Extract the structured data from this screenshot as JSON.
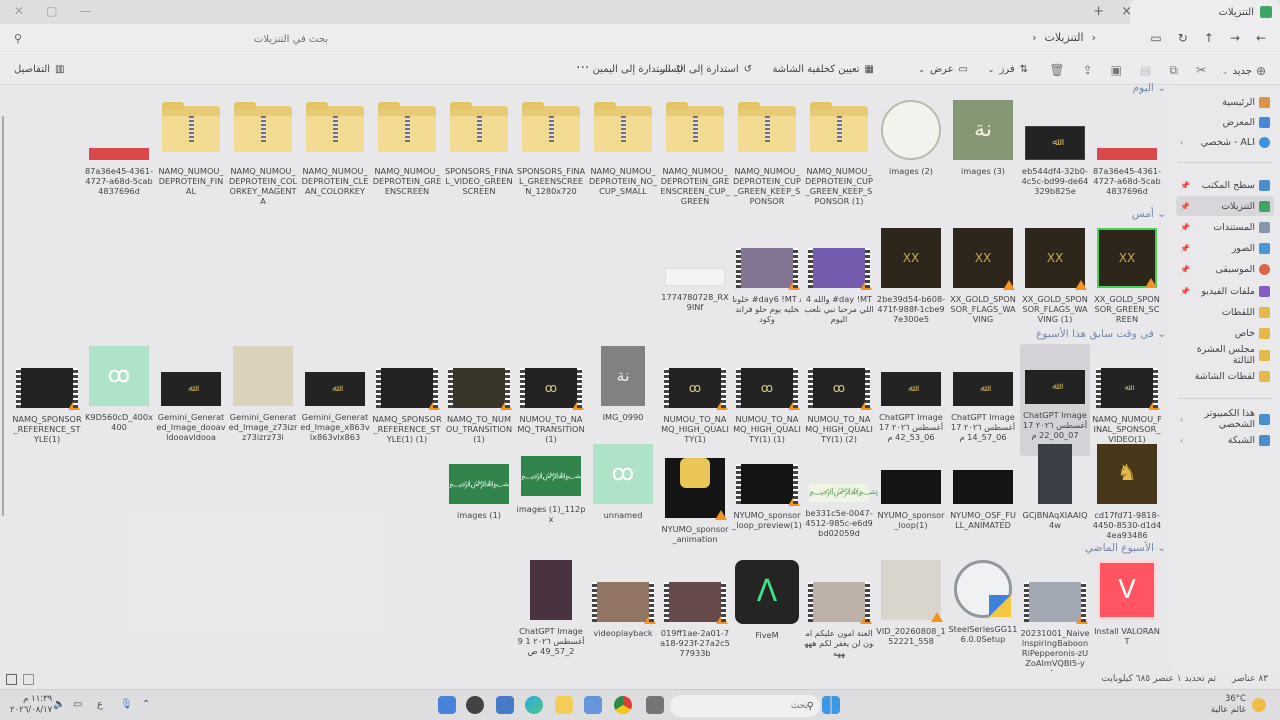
{
  "window": {
    "tab_title": "التنزيلات",
    "new_tab": "+",
    "close_tab": "×"
  },
  "address": {
    "crumbs": [
      "التنزيلات",
      "›"
    ],
    "search_placeholder": "بحث في التنزيلات"
  },
  "toolbar": {
    "new_label": "جديد",
    "sort_label": "فرز",
    "view_label": "عرض",
    "set_background": "تعيين كخلفية الشاشة",
    "rotate_left": "استدارة إلى اليسار",
    "rotate_right": "استدارة إلى اليمين",
    "more": "···",
    "details": "التفاصيل"
  },
  "sidebar": {
    "items": [
      {
        "label": "الرئيسية",
        "color": "#d98a3a"
      },
      {
        "label": "المعرض",
        "color": "#3a7bd5"
      },
      {
        "label": "ALI - شخصي",
        "color": "#2b8ae0"
      },
      {
        "label": "سطح المكتب",
        "color": "#3a86c8"
      },
      {
        "label": "التنزيلات",
        "color": "#2e9e5b"
      },
      {
        "label": "المستندات",
        "color": "#7d8ea6"
      },
      {
        "label": "الصور",
        "color": "#3a8fd6"
      },
      {
        "label": "الموسيقى",
        "color": "#d75a3a"
      },
      {
        "label": "ملفات الفيديو",
        "color": "#7a4fc4"
      },
      {
        "label": "اللقطات",
        "color": "#e3b23c"
      },
      {
        "label": "خاص",
        "color": "#e3b23c"
      },
      {
        "label": "مجلس العشرة الثالثة",
        "color": "#e3b23c"
      },
      {
        "label": "لقطات الشاشة",
        "color": "#e3b23c"
      },
      {
        "label": "هذا الكمبيوتر الشخصي",
        "color": "#3a86c8"
      },
      {
        "label": "الشبكة",
        "color": "#3a86c8"
      }
    ]
  },
  "groups": {
    "today": "اليوم",
    "yesterday": "أمس",
    "earlier_week": "في وقت سابق هذا الأسبوع",
    "last_week": "الأسبوع الماضي"
  },
  "files": {
    "row1": [
      "87a36e45-4361-4727-a68d-5cab4837696d",
      "eb544df4-32b0-4c5c-bd99-de64329b825e",
      "images (3)",
      "images (2)",
      "NAMQ_NUMOU_DEPROTEIN_CUP_GREEN_KEEP_SPONSOR (1)",
      "NAMQ_NUMOU_DEPROTEIN_CUP_GREEN_KEEP_SPONSOR",
      "NAMQ_NUMOU_DEPROTEIN_GREENSCREEN_CUP_GREEN",
      "NAMQ_NUMOU_DEPROTEIN_NO_CUP_SMALL",
      "SPONSORS_FINAL_GREENSCREEN_1280x720",
      "SPONSORS_FINAL_VIDEO_GREENSCREEN",
      "NAMQ_NUMOU_DEPROTEIN_GREENSCREEN",
      "NAMQ_NUMOU_DEPROTEIN_CLEAN_COLORKEY",
      "NAMQ_NUMOU_DEPROTEIN_COLORKEY_MAGENTA",
      "NAMQ_NUMOU_DEPROTEIN_FINAL",
      "87a36e45-4361-4727-a68d-5cab4837696d"
    ],
    "row2": [
      "XX_GOLD_SPONSOR_GREEN_SCREEN",
      "XX_GOLD_SPONSOR_FLAGS_WAVING (1)",
      "XX_GOLD_SPONSOR_FLAGS_WAVING",
      "2be39d54-b608-471f-988f-1cbe97e300e5",
      "والله 4 #day !MT اللي مرحبا نبي نلعب اليوم",
      "خلونا #day6 !MT نخليه يوم حلو فراند وكود",
      "1774780728_RX9INf"
    ],
    "row3": [
      "NAMQ_NUMOU_FINAL_SPONSOR_VIDEO(1)",
      "ChatGPT Image 17 أغسطس ٢٠٢٦ 07_00_22 م",
      "ChatGPT Image 17 أغسطس ٢٠٢٦ 06_57_14 م",
      "ChatGPT Image 17 أغسطس ٢٠٢٦ 06_53_42 م",
      "NUMOU_TO_NAMQ_HIGH_QUALITY(1) (2)",
      "NUMOU_TO_NAMQ_HIGH_QUALITY(1) (1)",
      "NUMOU_TO_NAMQ_HIGH_QUALITY(1)",
      "IMG_0990",
      "NUMOU_TO_NAMQ_TRANSITION(1)",
      "NAMQ_TO_NUMOU_TRANSITION (1)",
      "NAMQ_SPONSOR_REFERENCE_STYLE(1) (1)",
      "Gemini_Generated_Image_x863vlx863vlx863",
      "Gemini_Generated_Image_z73izrz73izrz73i",
      "Gemini_Generated_Image_dooavldooavldooa",
      "K9D560cD_400x400",
      "NAMQ_SPONSOR_REFERENCE_STYLE(1)"
    ],
    "row4": [
      "cd17fd71-9818-4450-8530-d1d44ea93486",
      "GCjBNAqXIAAIQ4w",
      "NYUMO_OSF_FULL_ANIMATED",
      "NYUMO_sponsor_loop(1)",
      "be331c5e-0047-4512-985c-e6d9bd02059d",
      "NYUMO_sponsor_loop_preview(1)",
      "NYUMO_sponsor_animation",
      "unnamed",
      "images (1)_112px",
      "images (1)"
    ],
    "row5": [
      "Install VALORANT",
      "20231001_NaivelnspiringBaboonRiPepperonis-zUZoAImVQBI5-y4...",
      "SteelSeriesGG116.0.0Setup",
      "VID_20260808_152221_558",
      "العنة امون عليكم امون لن يغفر لكم هههههه",
      "FiveM",
      "019ff1ae-2a01-7a18-923f-27a2c577933b",
      "videoplayback",
      "ChatGPT Image 9 أغسطس ٢٠٢٦ 12_57_49 ص"
    ]
  },
  "status": {
    "count": "٨٣ عناصر",
    "selected": "تم تحديد ١ عنصر  ٦٨٥ كيلوبايت"
  },
  "taskbar": {
    "temp": "36°C",
    "weather": "غائم عالية",
    "search": "بحث",
    "time": "١١:٣٩ م",
    "date": "٢٠٢٦/٠٨/١٧"
  }
}
